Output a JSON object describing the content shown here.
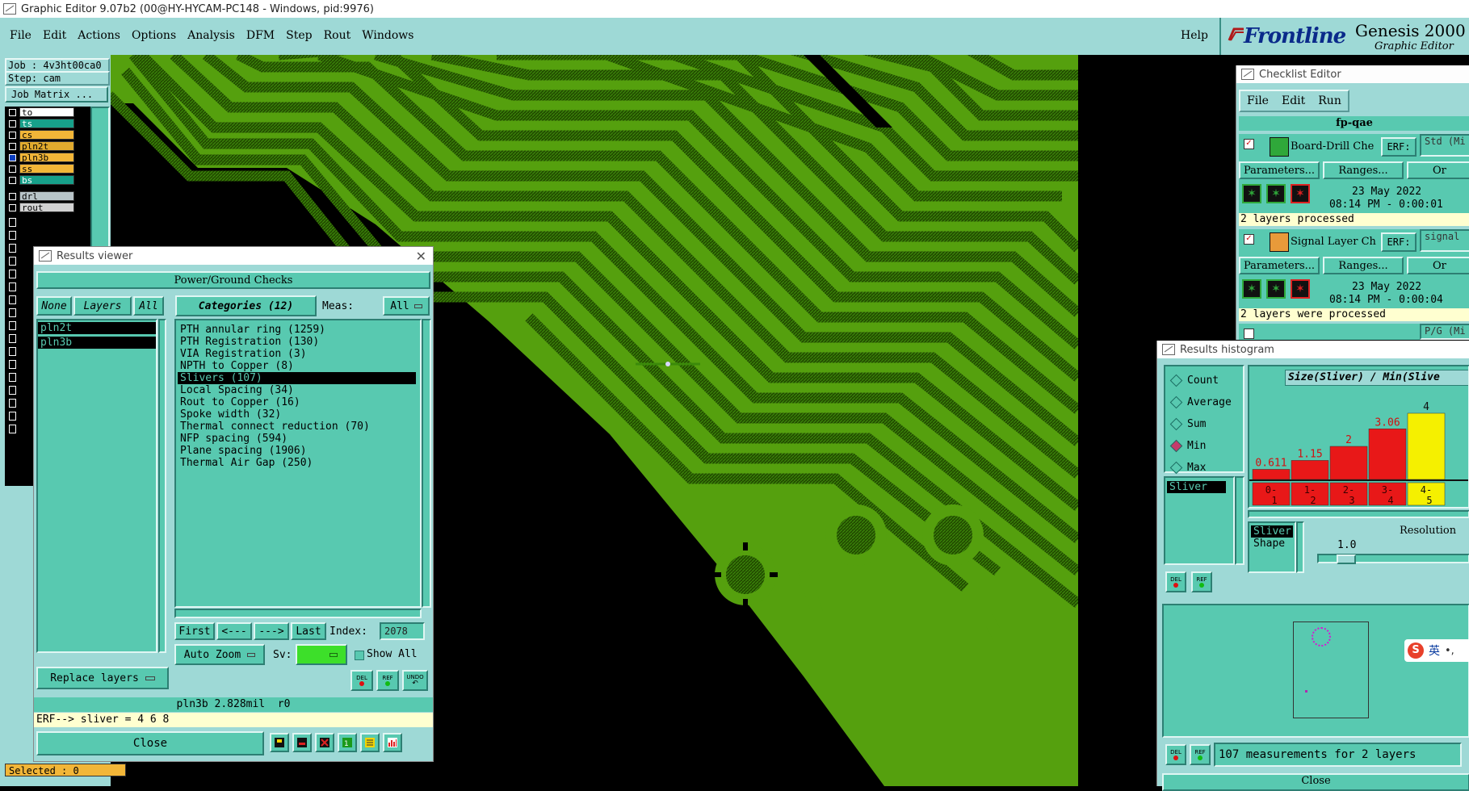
{
  "window_title": "Graphic Editor 9.07b2 (00@HY-HYCAM-PC148 - Windows, pid:9976)",
  "menu": [
    "File",
    "Edit",
    "Actions",
    "Options",
    "Analysis",
    "DFM",
    "Step",
    "Rout",
    "Windows"
  ],
  "help": "Help",
  "brand": {
    "logo": "Frontline",
    "product": "Genesis 2000",
    "subtitle": "Graphic Editor"
  },
  "job": {
    "job_line": "Job : 4v3ht00ca0",
    "step_line": "Step: cam",
    "matrix_btn": "Job Matrix ..."
  },
  "layers": [
    "to",
    "ts",
    "cs",
    "pln2t",
    "pln3b",
    "ss",
    "bs",
    "drl",
    "rout"
  ],
  "selected_status": "Selected : 0",
  "results_viewer": {
    "title": "Results viewer",
    "header": "Power/Ground Checks",
    "none_btn": "None",
    "layers_btn": "Layers",
    "all_btn": "All",
    "categories_btn": "Categories (12)",
    "meas_label": "Meas:",
    "meas_value": "All",
    "layer_list": [
      "pln2t",
      "pln3b"
    ],
    "categories": [
      "PTH annular ring (1259)",
      "PTH Registration (130)",
      "VIA Registration (3)",
      "NPTH to Copper (8)",
      "Slivers (107)",
      "Local Spacing (34)",
      "Rout to Copper (16)",
      "Spoke width (32)",
      "Thermal connect reduction (70)",
      "NFP spacing (594)",
      "Plane spacing (1906)",
      "Thermal Air Gap (250)"
    ],
    "selected_category": "Slivers (107)",
    "first_btn": "First",
    "prev_btn": "<---",
    "next_btn": "--->",
    "last_btn": "Last",
    "index_label": "Index:",
    "index_value": "2078",
    "autozoom_btn": "Auto Zoom",
    "sv_label": "Sv:",
    "show_all": "Show All",
    "replace_btn": "Replace layers",
    "del_btn": "DEL",
    "ref_btn": "REF",
    "undo_btn": "UNDO",
    "info_line": "pln3b 2.828mil  r0",
    "erf_line": "ERF--> sliver = 4 6 8",
    "close_btn": "Close"
  },
  "checklist": {
    "title": "Checklist Editor",
    "menu": [
      "File",
      "Edit",
      "Run"
    ],
    "name": "fp-qae",
    "items": [
      {
        "name": "Board-Drill Che",
        "erf_label": "ERF:",
        "erf_value": "Std (Mi",
        "params_btn": "Parameters...",
        "ranges_btn": "Ranges...",
        "extra_btn": "Or",
        "date": "23 May 2022",
        "time": "08:14 PM - 0:00:01",
        "status": "2 layers processed"
      },
      {
        "name": "Signal Layer Ch",
        "erf_label": "ERF:",
        "erf_value": "signal",
        "params_btn": "Parameters...",
        "ranges_btn": "Ranges...",
        "extra_btn": "Or",
        "date": "23 May 2022",
        "time": "08:14 PM - 0:00:04",
        "status": "2 layers were processed"
      }
    ],
    "partial_erf": "P/G (Mi"
  },
  "histogram": {
    "title": "Results histogram",
    "modes": [
      "Count",
      "Average",
      "Sum",
      "Min",
      "Max"
    ],
    "selected_mode": "Min",
    "chart_title": "Size(Sliver) / Min(Slive",
    "list": [
      "Sliver"
    ],
    "shape_list": [
      "Sliver",
      "Shape"
    ],
    "resolution_label": "Resolution",
    "resolution_value": "1.0",
    "del_btn": "DEL",
    "ref_btn": "REF",
    "status": "107 measurements for 2 layers",
    "close_btn": "Close"
  },
  "chart_data": {
    "type": "bar",
    "categories": [
      "0-1",
      "1-2",
      "2-3",
      "3-4",
      "4-5"
    ],
    "values": [
      0.611,
      1.15,
      2,
      3.06,
      4
    ],
    "colors": [
      "#e81818",
      "#e81818",
      "#e81818",
      "#e81818",
      "#f5f000"
    ]
  },
  "ime": {
    "label": "英"
  }
}
